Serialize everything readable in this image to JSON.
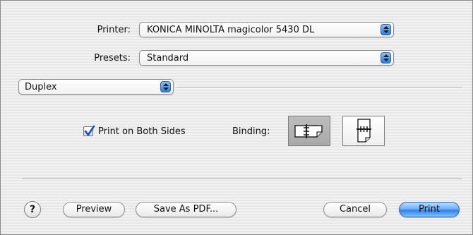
{
  "printer": {
    "label": "Printer:",
    "value": "KONICA MINOLTA magicolor 5430 DL"
  },
  "presets": {
    "label": "Presets:",
    "value": "Standard"
  },
  "panel": {
    "value": "Duplex"
  },
  "duplex": {
    "checkbox_label": "Print on Both Sides",
    "checked": true,
    "binding_label": "Binding:",
    "binding_selected": "left-edge"
  },
  "buttons": {
    "help": "?",
    "preview": "Preview",
    "save_pdf": "Save As PDF...",
    "cancel": "Cancel",
    "print": "Print"
  },
  "colors": {
    "accent": "#2f82ea",
    "background": "#ececec"
  }
}
